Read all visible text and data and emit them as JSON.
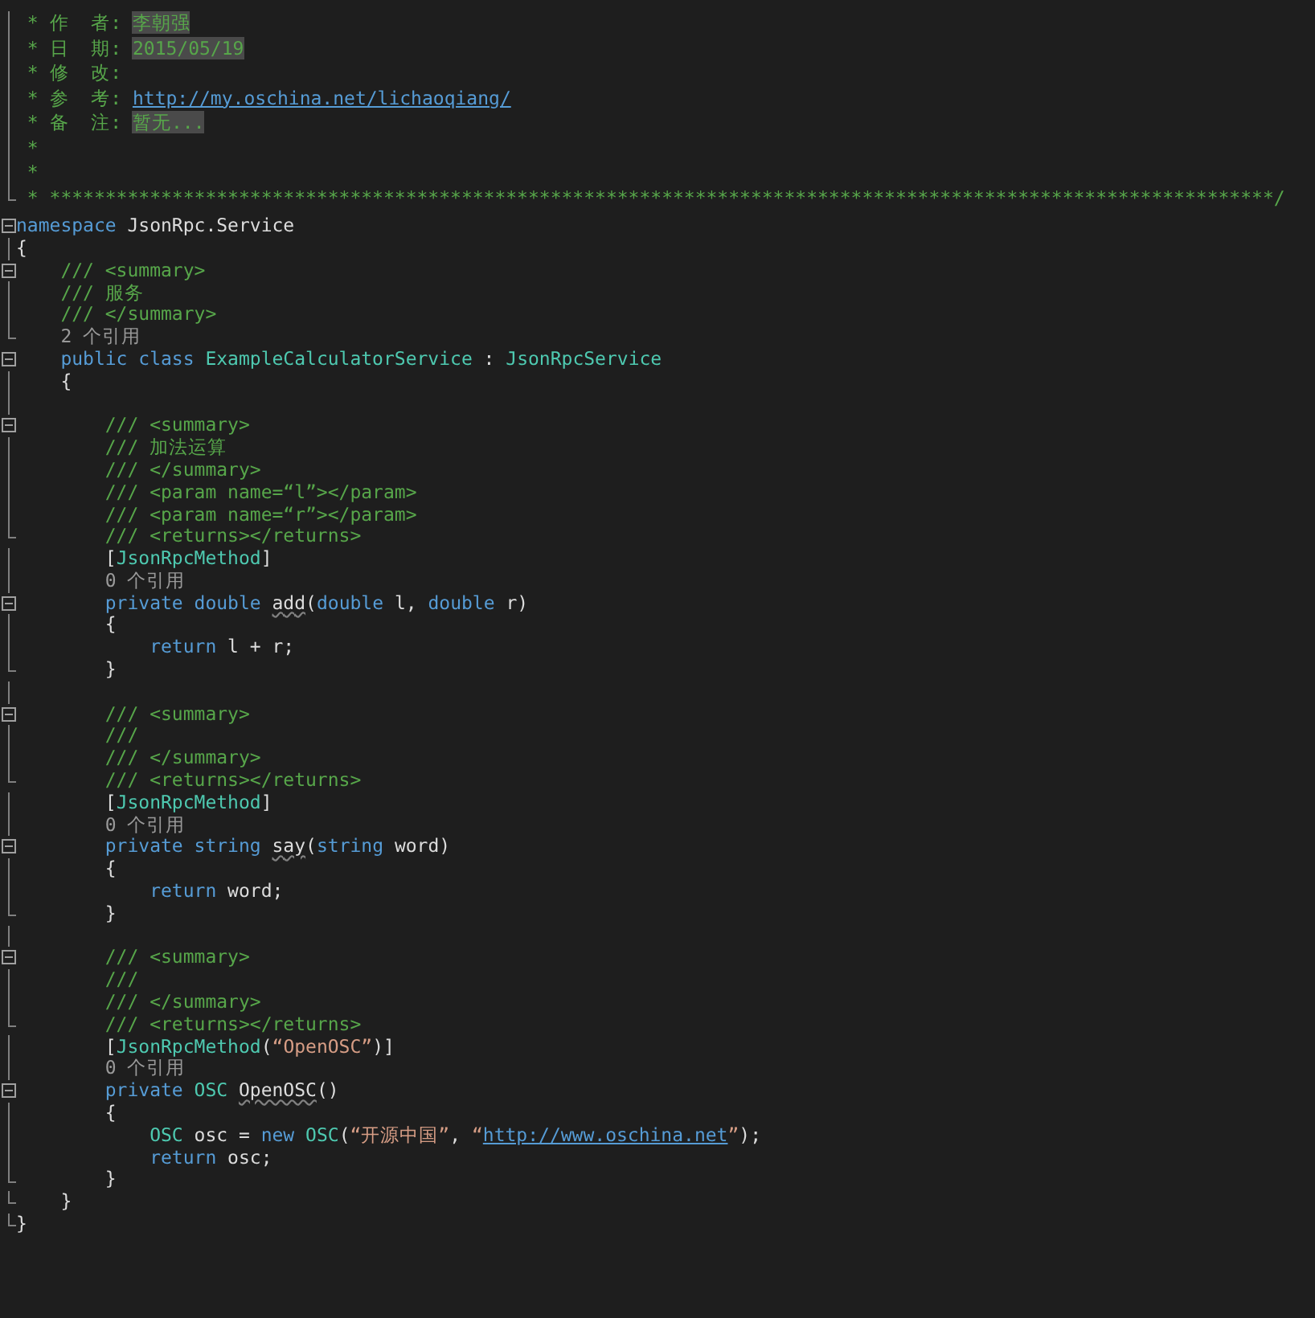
{
  "header_lines": [
    {
      "collapsible": false,
      "block_end": false,
      "segments": [
        {
          "kind": "comment",
          "text": " * 作  者: "
        },
        {
          "kind": "field",
          "text": "李朝强"
        }
      ]
    },
    {
      "collapsible": false,
      "block_end": false,
      "segments": [
        {
          "kind": "comment",
          "text": " * 日  期: "
        },
        {
          "kind": "field",
          "text": "2015/05/19"
        }
      ]
    },
    {
      "collapsible": false,
      "block_end": false,
      "segments": [
        {
          "kind": "comment",
          "text": " * 修  改:"
        }
      ]
    },
    {
      "collapsible": false,
      "block_end": false,
      "segments": [
        {
          "kind": "comment",
          "text": " * 参  考: "
        },
        {
          "kind": "url",
          "text": "http://my.oschina.net/lichaoqiang/"
        }
      ]
    },
    {
      "collapsible": false,
      "block_end": false,
      "segments": [
        {
          "kind": "comment",
          "text": " * 备  注: "
        },
        {
          "kind": "field",
          "text": "暂无..."
        }
      ]
    },
    {
      "collapsible": false,
      "block_end": false,
      "segments": [
        {
          "kind": "comment",
          "text": " *"
        }
      ]
    },
    {
      "collapsible": false,
      "block_end": false,
      "segments": [
        {
          "kind": "comment",
          "text": " *"
        }
      ]
    },
    {
      "collapsible": false,
      "block_end": true,
      "segments": [
        {
          "kind": "comment",
          "text": " * **************************************************************************************************************/"
        }
      ]
    }
  ],
  "code_lines": [
    {
      "collapsible": true,
      "block_end": false,
      "segments": [
        {
          "kind": "keyword",
          "text": "namespace"
        },
        {
          "kind": "plain",
          "text": " JsonRpc.Service"
        }
      ]
    },
    {
      "collapsible": false,
      "block_end": false,
      "segments": [
        {
          "kind": "plain",
          "text": "{"
        }
      ]
    },
    {
      "collapsible": true,
      "block_end": false,
      "segments": [
        {
          "kind": "comment",
          "text": "    /// <summary>"
        }
      ]
    },
    {
      "collapsible": false,
      "block_end": false,
      "segments": [
        {
          "kind": "comment",
          "text": "    /// 服务"
        }
      ]
    },
    {
      "collapsible": false,
      "block_end": false,
      "segments": [
        {
          "kind": "comment",
          "text": "    /// </summary>"
        }
      ]
    },
    {
      "collapsible": false,
      "block_end": true,
      "segments": [
        {
          "kind": "codelens",
          "text": "    2 个引用"
        }
      ]
    },
    {
      "collapsible": true,
      "block_end": false,
      "segments": [
        {
          "kind": "keyword",
          "text": "    public class "
        },
        {
          "kind": "type",
          "text": "ExampleCalculatorService"
        },
        {
          "kind": "plain",
          "text": " : "
        },
        {
          "kind": "type",
          "text": "JsonRpcService"
        }
      ]
    },
    {
      "collapsible": false,
      "block_end": false,
      "segments": [
        {
          "kind": "plain",
          "text": "    {"
        }
      ]
    },
    {
      "collapsible": false,
      "block_end": false
    },
    {
      "collapsible": true,
      "block_end": false,
      "segments": [
        {
          "kind": "comment",
          "text": "        /// <summary>"
        }
      ]
    },
    {
      "collapsible": false,
      "block_end": false,
      "segments": [
        {
          "kind": "comment",
          "text": "        /// 加法运算"
        }
      ]
    },
    {
      "collapsible": false,
      "block_end": false,
      "segments": [
        {
          "kind": "comment",
          "text": "        /// </summary>"
        }
      ]
    },
    {
      "collapsible": false,
      "block_end": false,
      "segments": [
        {
          "kind": "comment",
          "text": "        /// <param name=“l”></param>"
        }
      ]
    },
    {
      "collapsible": false,
      "block_end": false,
      "segments": [
        {
          "kind": "comment",
          "text": "        /// <param name=“r”></param>"
        }
      ]
    },
    {
      "collapsible": false,
      "block_end": true,
      "segments": [
        {
          "kind": "comment",
          "text": "        /// <returns></returns>"
        }
      ]
    },
    {
      "collapsible": false,
      "block_end": false,
      "segments": [
        {
          "kind": "plain",
          "text": "        ["
        },
        {
          "kind": "type",
          "text": "JsonRpcMethod"
        },
        {
          "kind": "plain",
          "text": "]"
        }
      ]
    },
    {
      "collapsible": false,
      "block_end": false,
      "segments": [
        {
          "kind": "codelens",
          "text": "        0 个引用"
        }
      ]
    },
    {
      "collapsible": true,
      "block_end": false,
      "segments": [
        {
          "kind": "keyword",
          "text": "        private double "
        },
        {
          "kind": "squiggle",
          "text": "add"
        },
        {
          "kind": "plain",
          "text": "("
        },
        {
          "kind": "keyword",
          "text": "double"
        },
        {
          "kind": "plain",
          "text": " l, "
        },
        {
          "kind": "keyword",
          "text": "double"
        },
        {
          "kind": "plain",
          "text": " r)"
        }
      ]
    },
    {
      "collapsible": false,
      "block_end": false,
      "segments": [
        {
          "kind": "plain",
          "text": "        {"
        }
      ]
    },
    {
      "collapsible": false,
      "block_end": false,
      "segments": [
        {
          "kind": "keyword",
          "text": "            return"
        },
        {
          "kind": "plain",
          "text": " l + r;"
        }
      ]
    },
    {
      "collapsible": false,
      "block_end": true,
      "segments": [
        {
          "kind": "plain",
          "text": "        }"
        }
      ]
    },
    {
      "collapsible": false,
      "block_end": false
    },
    {
      "collapsible": true,
      "block_end": false,
      "segments": [
        {
          "kind": "comment",
          "text": "        /// <summary>"
        }
      ]
    },
    {
      "collapsible": false,
      "block_end": false,
      "segments": [
        {
          "kind": "comment",
          "text": "        ///"
        }
      ]
    },
    {
      "collapsible": false,
      "block_end": false,
      "segments": [
        {
          "kind": "comment",
          "text": "        /// </summary>"
        }
      ]
    },
    {
      "collapsible": false,
      "block_end": true,
      "segments": [
        {
          "kind": "comment",
          "text": "        /// <returns></returns>"
        }
      ]
    },
    {
      "collapsible": false,
      "block_end": false,
      "segments": [
        {
          "kind": "plain",
          "text": "        ["
        },
        {
          "kind": "type",
          "text": "JsonRpcMethod"
        },
        {
          "kind": "plain",
          "text": "]"
        }
      ]
    },
    {
      "collapsible": false,
      "block_end": false,
      "segments": [
        {
          "kind": "codelens",
          "text": "        0 个引用"
        }
      ]
    },
    {
      "collapsible": true,
      "block_end": false,
      "segments": [
        {
          "kind": "keyword",
          "text": "        private string "
        },
        {
          "kind": "squiggle",
          "text": "say"
        },
        {
          "kind": "plain",
          "text": "("
        },
        {
          "kind": "keyword",
          "text": "string"
        },
        {
          "kind": "plain",
          "text": " word)"
        }
      ]
    },
    {
      "collapsible": false,
      "block_end": false,
      "segments": [
        {
          "kind": "plain",
          "text": "        {"
        }
      ]
    },
    {
      "collapsible": false,
      "block_end": false,
      "segments": [
        {
          "kind": "keyword",
          "text": "            return"
        },
        {
          "kind": "plain",
          "text": " word;"
        }
      ]
    },
    {
      "collapsible": false,
      "block_end": true,
      "segments": [
        {
          "kind": "plain",
          "text": "        }"
        }
      ]
    },
    {
      "collapsible": false,
      "block_end": false
    },
    {
      "collapsible": true,
      "block_end": false,
      "segments": [
        {
          "kind": "comment",
          "text": "        /// <summary>"
        }
      ]
    },
    {
      "collapsible": false,
      "block_end": false,
      "segments": [
        {
          "kind": "comment",
          "text": "        ///"
        }
      ]
    },
    {
      "collapsible": false,
      "block_end": false,
      "segments": [
        {
          "kind": "comment",
          "text": "        /// </summary>"
        }
      ]
    },
    {
      "collapsible": false,
      "block_end": true,
      "segments": [
        {
          "kind": "comment",
          "text": "        /// <returns></returns>"
        }
      ]
    },
    {
      "collapsible": false,
      "block_end": false,
      "segments": [
        {
          "kind": "plain",
          "text": "        ["
        },
        {
          "kind": "type",
          "text": "JsonRpcMethod"
        },
        {
          "kind": "plain",
          "text": "("
        },
        {
          "kind": "string",
          "text": "“OpenOSC”"
        },
        {
          "kind": "plain",
          "text": ")]"
        }
      ]
    },
    {
      "collapsible": false,
      "block_end": false,
      "segments": [
        {
          "kind": "codelens",
          "text": "        0 个引用"
        }
      ]
    },
    {
      "collapsible": true,
      "block_end": false,
      "segments": [
        {
          "kind": "keyword",
          "text": "        private "
        },
        {
          "kind": "type",
          "text": "OSC "
        },
        {
          "kind": "squiggle",
          "text": "OpenOSC"
        },
        {
          "kind": "plain",
          "text": "()"
        }
      ]
    },
    {
      "collapsible": false,
      "block_end": false,
      "segments": [
        {
          "kind": "plain",
          "text": "        {"
        }
      ]
    },
    {
      "collapsible": false,
      "block_end": false,
      "segments": [
        {
          "kind": "type",
          "text": "            OSC"
        },
        {
          "kind": "plain",
          "text": " osc = "
        },
        {
          "kind": "keyword",
          "text": "new "
        },
        {
          "kind": "type",
          "text": "OSC"
        },
        {
          "kind": "plain",
          "text": "("
        },
        {
          "kind": "string",
          "text": "“开源中国”"
        },
        {
          "kind": "plain",
          "text": ", "
        },
        {
          "kind": "string",
          "text": "“"
        },
        {
          "kind": "url",
          "text": "http://www.oschina.net"
        },
        {
          "kind": "string",
          "text": "”"
        },
        {
          "kind": "plain",
          "text": ");"
        }
      ]
    },
    {
      "collapsible": false,
      "block_end": false,
      "segments": [
        {
          "kind": "keyword",
          "text": "            return"
        },
        {
          "kind": "plain",
          "text": " osc;"
        }
      ]
    },
    {
      "collapsible": false,
      "block_end": true,
      "segments": [
        {
          "kind": "plain",
          "text": "        }"
        }
      ]
    },
    {
      "collapsible": false,
      "block_end": true,
      "segments": [
        {
          "kind": "plain",
          "text": "    }"
        }
      ]
    },
    {
      "collapsible": false,
      "block_end": true,
      "segments": [
        {
          "kind": "plain",
          "text": "}"
        }
      ]
    }
  ]
}
